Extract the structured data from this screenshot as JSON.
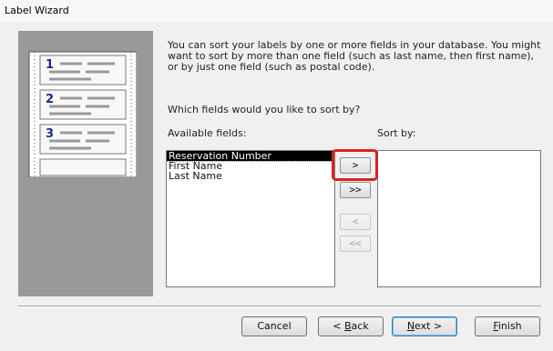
{
  "window": {
    "title": "Label Wizard"
  },
  "description": "You can sort your labels by one or more fields in your database.  You might want to sort by more than one field (such as last name, then first name), or by just one field (such as postal code).",
  "question": "Which fields would you like to sort by?",
  "available_fields": {
    "label": "Available fields:",
    "items": [
      "Reservation Number",
      "First Name",
      "Last Name"
    ],
    "selected_index": 0
  },
  "sort_by": {
    "label": "Sort by:",
    "items": []
  },
  "mover_buttons": {
    "add_one": ">",
    "add_all": ">>",
    "remove_one": "<",
    "remove_all": "<<"
  },
  "footer": {
    "cancel": "Cancel",
    "back_prefix": "< ",
    "back_accel": "B",
    "back_rest": "ack",
    "next_accel": "N",
    "next_rest": "ext >",
    "finish_accel": "F",
    "finish_rest": "inish"
  },
  "colors": {
    "highlight": "#e0201d",
    "side_panel": "#999999"
  }
}
